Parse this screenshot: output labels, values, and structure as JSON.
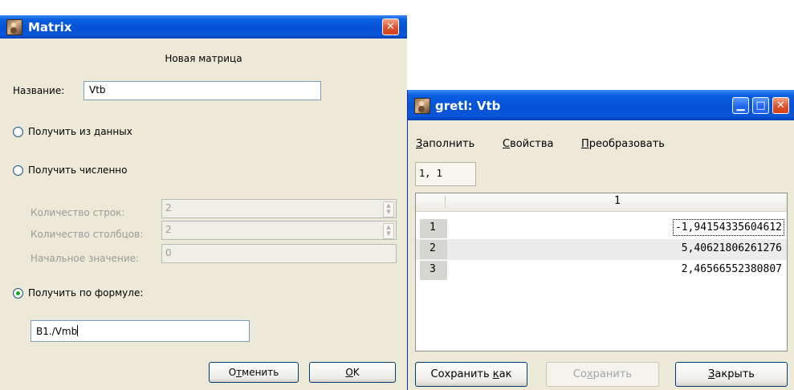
{
  "matrix_dialog": {
    "title": "Matrix",
    "heading": "Новая матрица",
    "name_label": "Название:",
    "name_value": "Vtb",
    "options": {
      "from_data": "Получить из данных",
      "numeric": "Получить численно",
      "formula": "Получить по формуле:"
    },
    "selected_option": "formula",
    "numeric_fields": {
      "rows_label": "Количество строк:",
      "rows_value": "2",
      "cols_label": "Количество столбцов:",
      "cols_value": "2",
      "init_label": "Начальное значение:",
      "init_value": "0"
    },
    "formula_value": "B1./Vmb",
    "buttons": {
      "cancel_pre": "О",
      "cancel_u": "т",
      "cancel_post": "менить",
      "ok_u": "O",
      "ok_post": "K"
    }
  },
  "gretl_window": {
    "title": "gretl: Vtb",
    "menu": [
      {
        "u": "З",
        "rest": "аполнить"
      },
      {
        "u": "С",
        "rest": "войства"
      },
      {
        "u": "П",
        "rest": "реобразовать"
      }
    ],
    "cell_indicator": "1, 1",
    "column_headers": [
      "1"
    ],
    "rows": [
      {
        "label": "1",
        "value": "-1,94154335604612"
      },
      {
        "label": "2",
        "value": "5,40621806261276"
      },
      {
        "label": "3",
        "value": "2,46566552380807"
      }
    ],
    "buttons": {
      "save_as_pre": "Сохранить ",
      "save_as_u": "к",
      "save_as_post": "ак",
      "save_pre": "Со",
      "save_u": "х",
      "save_post": "ранить",
      "close_u": "З",
      "close_post": "акрыть"
    }
  },
  "colors": {
    "titlebar": "#0551d6",
    "dialog_bg": "#ece9d8",
    "close_button": "#e0512a"
  }
}
